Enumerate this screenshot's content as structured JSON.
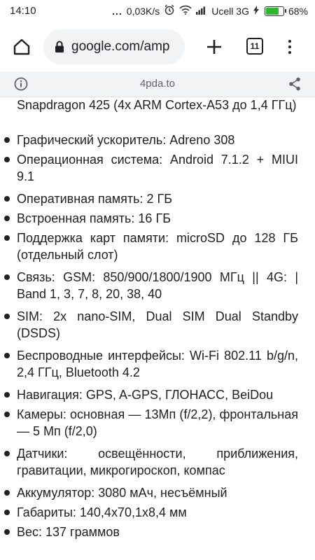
{
  "status_bar": {
    "time": "14:10",
    "dots": "...",
    "net_speed": "0,03K/s",
    "carrier": "Ucell 3G",
    "battery_percent": "68%",
    "battery_level": 0.68
  },
  "toolbar": {
    "url": "google.com/amp",
    "tab_count": "11"
  },
  "amp_bar": {
    "domain": "4pda.to"
  },
  "content": {
    "lines": [
      "Snapdragon 425 (4x ARM Cortex-A53 до 1,4 ГГц)",
      "Графический ускоритель: Adreno 308",
      "Операционная система: Android 7.1.2 + MIUI 9.1",
      "Оперативная память: 2 ГБ",
      "Встроенная память: 16 ГБ",
      "Поддержка карт памяти: microSD до 128 ГБ (отдельный слот)",
      "Связь: GSM: 850/900/1800/1900 МГц || 4G: | Band 1, 3, 7, 8, 20, 38, 40",
      "SIM: 2x nano-SIM, Dual SIM Dual Standby (DSDS)",
      "Беспроводные интерфейсы: Wi-Fi 802.11 b/g/n, 2,4 ГГц, Bluetooth 4.2",
      "Навигация: GPS, A-GPS, ГЛОНАСС, BeiDou",
      "Камеры: основная — 13Мп (f/2,2), фронтальная — 5 Мп (f/2,0)",
      "Датчики: освещённости, приближения, гравитации, микрогироскоп, компас",
      "Аккумулятор: 3080 мАч, несъёмный",
      "Габариты: 140,4x70,1x8,4 мм",
      "Вес: 137 граммов"
    ]
  }
}
